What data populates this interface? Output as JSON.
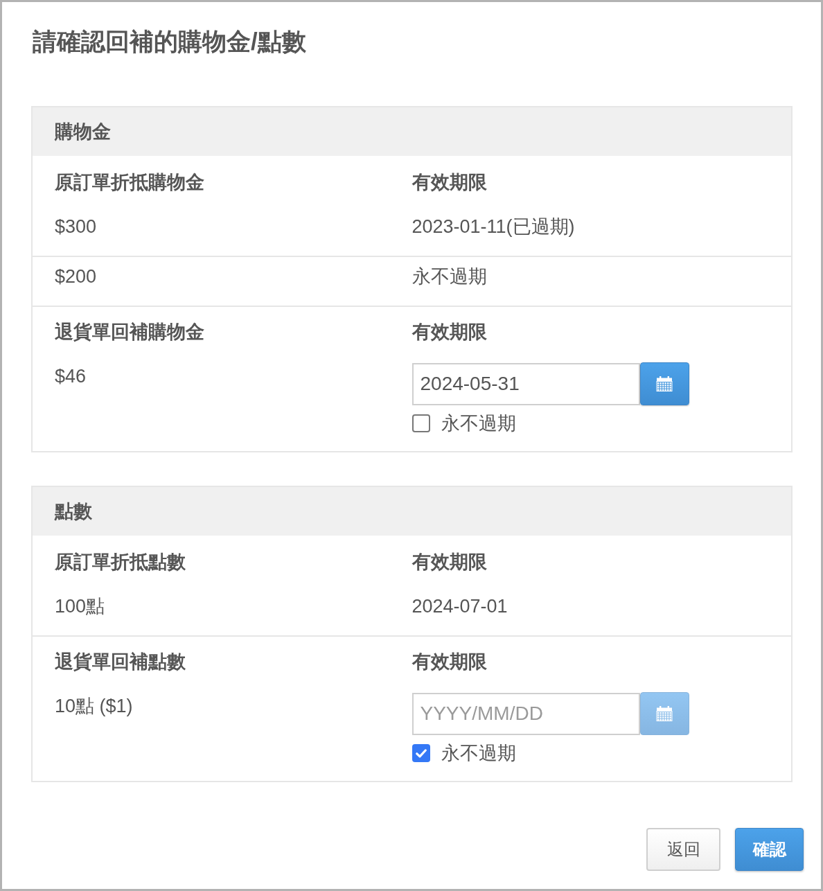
{
  "title": "請確認回補的購物金/點數",
  "sections": [
    {
      "heading": "購物金",
      "rows": [
        {
          "kind": "fixed",
          "label": "原訂單折抵購物金",
          "expiry_label": "有效期限",
          "amount": "$300",
          "expiry": "2023-01-11(已過期)"
        },
        {
          "kind": "fixed",
          "amount": "$200",
          "expiry": "永不過期"
        },
        {
          "kind": "editable",
          "label": "退貨單回補購物金",
          "expiry_label": "有效期限",
          "amount": "$46",
          "date_field": {
            "value": "2024-05-31",
            "disabled": false
          },
          "never_expire": {
            "label": "永不過期",
            "checked": false
          }
        }
      ]
    },
    {
      "heading": "點數",
      "rows": [
        {
          "kind": "fixed",
          "label": "原訂單折抵點數",
          "expiry_label": "有效期限",
          "amount": "100點",
          "expiry": "2024-07-01"
        },
        {
          "kind": "editable",
          "label": "退貨單回補點數",
          "expiry_label": "有效期限",
          "amount": "10點 ($1)",
          "date_field": {
            "placeholder": "YYYY/MM/DD",
            "disabled": true
          },
          "never_expire": {
            "label": "永不過期",
            "checked": true
          }
        }
      ]
    }
  ],
  "buttons": [
    {
      "kind": "secondary",
      "label": "返回"
    },
    {
      "kind": "primary",
      "label": "確認"
    }
  ]
}
